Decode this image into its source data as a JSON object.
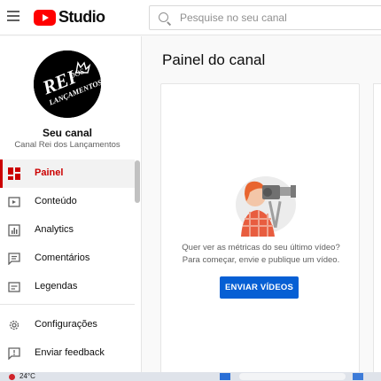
{
  "header": {
    "logo_text": "Studio",
    "search_placeholder": "Pesquise no seu canal"
  },
  "channel": {
    "avatar_text_line1": "REI",
    "avatar_text_line2": "DOS",
    "avatar_text_line3": "LANÇAMENTOS",
    "label": "Seu canal",
    "name": "Canal Rei dos Lançamentos"
  },
  "sidebar": {
    "items": [
      {
        "label": "Painel",
        "icon": "dashboard-icon",
        "active": true
      },
      {
        "label": "Conteúdo",
        "icon": "content-icon"
      },
      {
        "label": "Analytics",
        "icon": "analytics-icon"
      },
      {
        "label": "Comentários",
        "icon": "comments-icon"
      },
      {
        "label": "Legendas",
        "icon": "subtitles-icon"
      },
      {
        "label": "Configurações",
        "icon": "settings-icon"
      },
      {
        "label": "Enviar feedback",
        "icon": "feedback-icon"
      }
    ]
  },
  "main": {
    "title": "Painel do canal",
    "empty_state_line1": "Quer ver as métricas do seu último vídeo?",
    "empty_state_line2": "Para começar, envie e publique um vídeo.",
    "upload_button": "ENVIAR VÍDEOS"
  },
  "taskbar": {
    "temperature": "24°C"
  },
  "colors": {
    "accent": "#cc0000",
    "button": "#065fd4",
    "brand": "#ff0000"
  }
}
